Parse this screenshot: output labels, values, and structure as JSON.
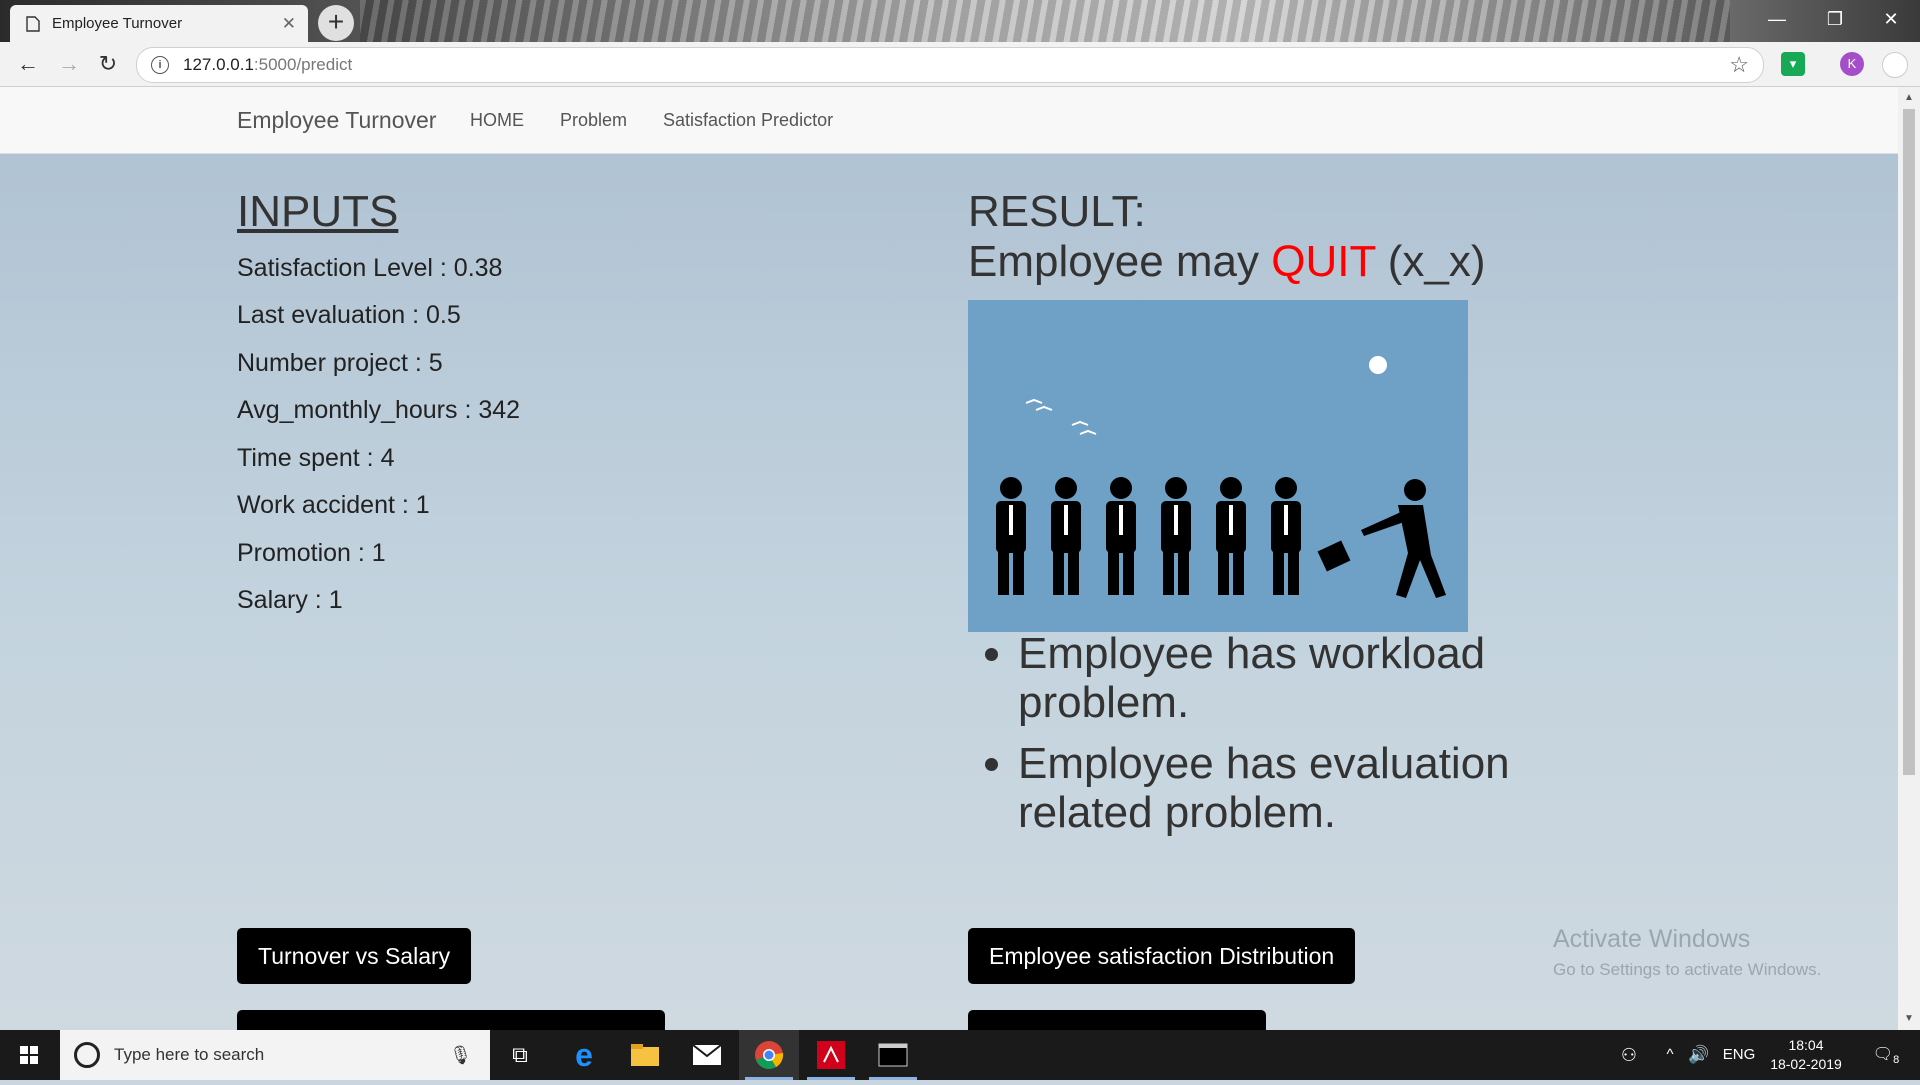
{
  "browser": {
    "tab_title": "Employee Turnover",
    "tab_close": "✕",
    "new_tab": "+",
    "url_host": "127.0.0.1",
    "url_path": ":5000/predict",
    "profile_initial": "K",
    "window": {
      "minimize": "—",
      "restore": "❐",
      "close": "✕"
    }
  },
  "navbar": {
    "brand": "Employee Turnover",
    "links": [
      "HOME",
      "Problem",
      "Satisfaction Predictor"
    ]
  },
  "inputs": {
    "title": "INPUTS",
    "rows": [
      "Satisfaction Level : 0.38",
      "Last evaluation : 0.5",
      "Number project : 5",
      "Avg_monthly_hours : 342",
      "Time spent : 4",
      "Work accident : 1",
      "Promotion : 1",
      "Salary : 1"
    ]
  },
  "result": {
    "label": "RESULT:",
    "prefix": "Employee may ",
    "verdict": "QUIT",
    "suffix": " (x_x)",
    "reasons": [
      "Employee has workload problem.",
      "Employee has evaluation related problem."
    ]
  },
  "buttons": {
    "turnover_salary": "Turnover vs Salary",
    "satisfaction_distribution": "Employee satisfaction Distribution"
  },
  "watermark": {
    "line1": "Activate Windows",
    "line2": "Go to Settings to activate Windows."
  },
  "taskbar": {
    "search_placeholder": "Type here to search",
    "language": "ENG",
    "time": "18:04",
    "date": "18-02-2019",
    "notification_count": "8"
  },
  "colors": {
    "quit": "#ff0000",
    "page_background": "#b8c9d6",
    "button": "#000000"
  }
}
